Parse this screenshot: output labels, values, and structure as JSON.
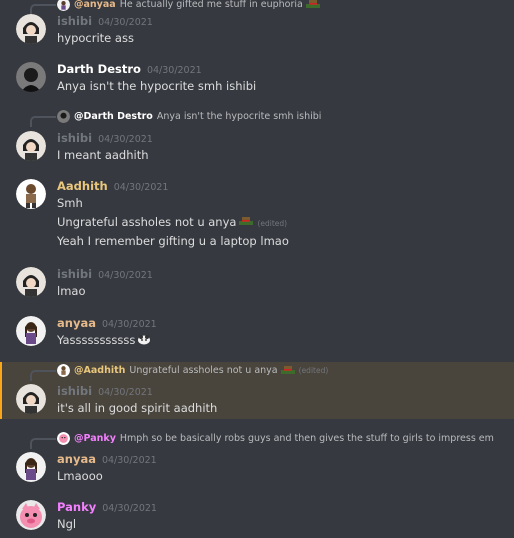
{
  "colors": {
    "background": "#36393f",
    "ishibi": "#72767d",
    "darth": "#ffffff",
    "aadhith": "#e9c77d",
    "anyaa": "#e6b98a",
    "panky": "#f47fff",
    "highlight": "#49443c",
    "mention_accent": "#faa61a"
  },
  "messages": [
    {
      "reply": {
        "author": "@anyaa",
        "text": "He actually gifted me stuff in euphoria",
        "emoji": "hat-emoji"
      },
      "author": "ishibi",
      "time": "04/30/2021",
      "lines": [
        "hypocrite ass"
      ]
    },
    {
      "author": "Darth Destro",
      "time": "04/30/2021",
      "lines": [
        "Anya isn't the hypocrite smh ishibi"
      ]
    },
    {
      "reply": {
        "author": "@Darth Destro",
        "text": "Anya isn't the hypocrite smh ishibi"
      },
      "author": "ishibi",
      "time": "04/30/2021",
      "lines": [
        "I meant aadhith"
      ]
    },
    {
      "author": "Aadhith",
      "time": "04/30/2021",
      "lines": [
        "Smh",
        "Ungrateful assholes not u anya",
        "Yeah I remember gifting u a  laptop lmao"
      ],
      "edited_label": "(edited)"
    },
    {
      "author": "ishibi",
      "time": "04/30/2021",
      "lines": [
        "lmao"
      ]
    },
    {
      "author": "anyaa",
      "time": "04/30/2021",
      "lines": [
        "Yasssssssssss"
      ]
    },
    {
      "reply": {
        "author": "@Aadhith",
        "text": "Ungrateful assholes not u anya",
        "edited_label": "(edited)"
      },
      "author": "ishibi",
      "time": "04/30/2021",
      "lines": [
        "it's all in good spirit aadhith"
      ]
    },
    {
      "reply": {
        "author": "@Panky",
        "text": "Hmph so be basically robs guys and then gives the stuff to girls to impress em"
      },
      "author": "anyaa",
      "time": "04/30/2021",
      "lines": [
        "Lmaooo"
      ]
    },
    {
      "author": "Panky",
      "time": "04/30/2021",
      "lines": [
        "Ngl"
      ]
    }
  ]
}
